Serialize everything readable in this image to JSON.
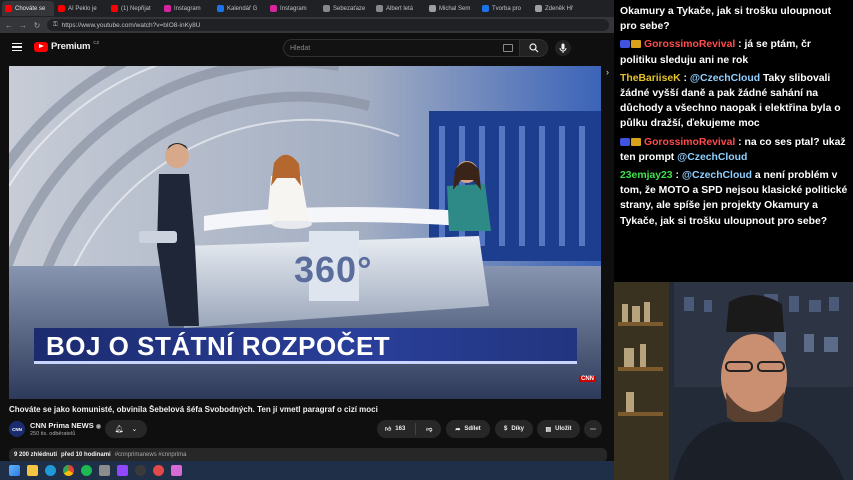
{
  "browser": {
    "tabs": [
      {
        "label": "Chováte se",
        "color": "#ff0000",
        "active": true
      },
      {
        "label": "AI Peklo je",
        "color": "#ff0000"
      },
      {
        "label": "(1) Nepřijat",
        "color": "#ff0000"
      },
      {
        "label": "Instagram",
        "color": "#d6249f"
      },
      {
        "label": "Kalendář G",
        "color": "#1a73e8"
      },
      {
        "label": "Instagram",
        "color": "#d6249f"
      },
      {
        "label": "Sebezaťaze",
        "color": "#888888"
      },
      {
        "label": "Albert letá",
        "color": "#888888"
      },
      {
        "label": "Michal Sem",
        "color": "#9aa0a6"
      },
      {
        "label": "Tvorba pro",
        "color": "#1a73e8"
      },
      {
        "label": "Zdeněk Hř",
        "color": "#9aa0a6"
      }
    ],
    "url": "https://www.youtube.com/watch?v=bIO8-inKy8U"
  },
  "youtube": {
    "logo_text": "Premium",
    "logo_sup": "CZ",
    "search_placeholder": "Hledat"
  },
  "video": {
    "lower_third": "BOJ O STÁTNÍ ROZPOČET",
    "studio_logo": "360°",
    "bug": "CNN"
  },
  "meta": {
    "title": "Chováte se jako komunisté, obvinila Šebelová šéfa Svobodných. Ten jí vmetl paragraf o cizí moci",
    "channel": "CNN Prima NEWS",
    "channel_avatar": "CNN",
    "subscribers": "250 tis. odběratelů",
    "likes": "163",
    "share": "Sdílet",
    "thanks": "Díky",
    "save": "Uložit",
    "views": "9 200 zhlédnutí",
    "posted": "před 10 hodinami",
    "hashtags": "#cnnprimanews #cnnprima"
  },
  "chat": [
    {
      "text": "Okamury a Tykače, jak si trošku uloupnout pro sebe?"
    },
    {
      "user": "GorossimoRevival",
      "user_color": "#ff4b4b",
      "badges": true,
      "text": "já se ptám, čr politiku sleduju ani ne rok"
    },
    {
      "user": "TheBariiseK",
      "user_color": "#e6c229",
      "badges": false,
      "mention": "@CzechCloud",
      "text": "Taky slibovali žádné vyšší daně a pak žádné sahání na důchody a všechno naopak i elektřina byla o půlku dražší, ďekujeme moc"
    },
    {
      "user": "GorossimoRevival",
      "user_color": "#ff4b4b",
      "badges": true,
      "text": "na co ses ptal? ukaž ten prompt",
      "mention_end": "@CzechCloud"
    },
    {
      "user": "23emjay23",
      "user_color": "#3fe04c",
      "badges": false,
      "mention": "@CzechCloud",
      "text": "a není problém v tom, že MOTO a SPD nejsou klasické politické strany, ale spíše jen projekty Okamury a Tykače, jak si trošku uloupnout pro sebe?"
    }
  ]
}
